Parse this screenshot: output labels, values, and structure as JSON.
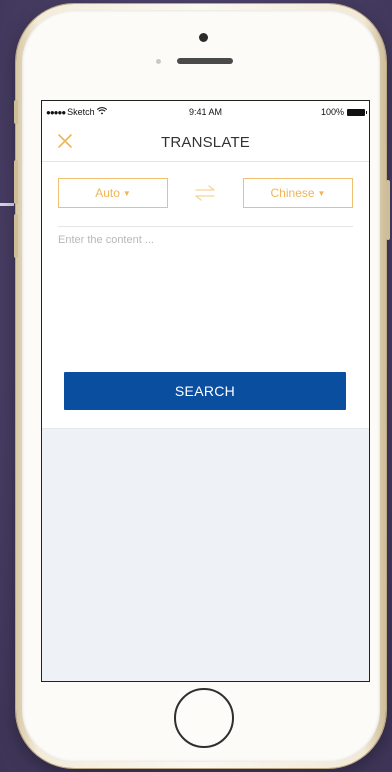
{
  "status_bar": {
    "carrier": "Sketch",
    "time": "9:41 AM",
    "battery": "100%"
  },
  "nav": {
    "title": "TRANSLATE",
    "close_icon": "close-icon"
  },
  "languages": {
    "source": "Auto",
    "target": "Chinese",
    "swap_icon": "swap-arrows-icon"
  },
  "input": {
    "placeholder": "Enter the content ...",
    "value": ""
  },
  "search_label": "SEARCH",
  "colors": {
    "accent": "#f0b558",
    "primary_button": "#0a4ea0",
    "background": "#4b4068"
  }
}
